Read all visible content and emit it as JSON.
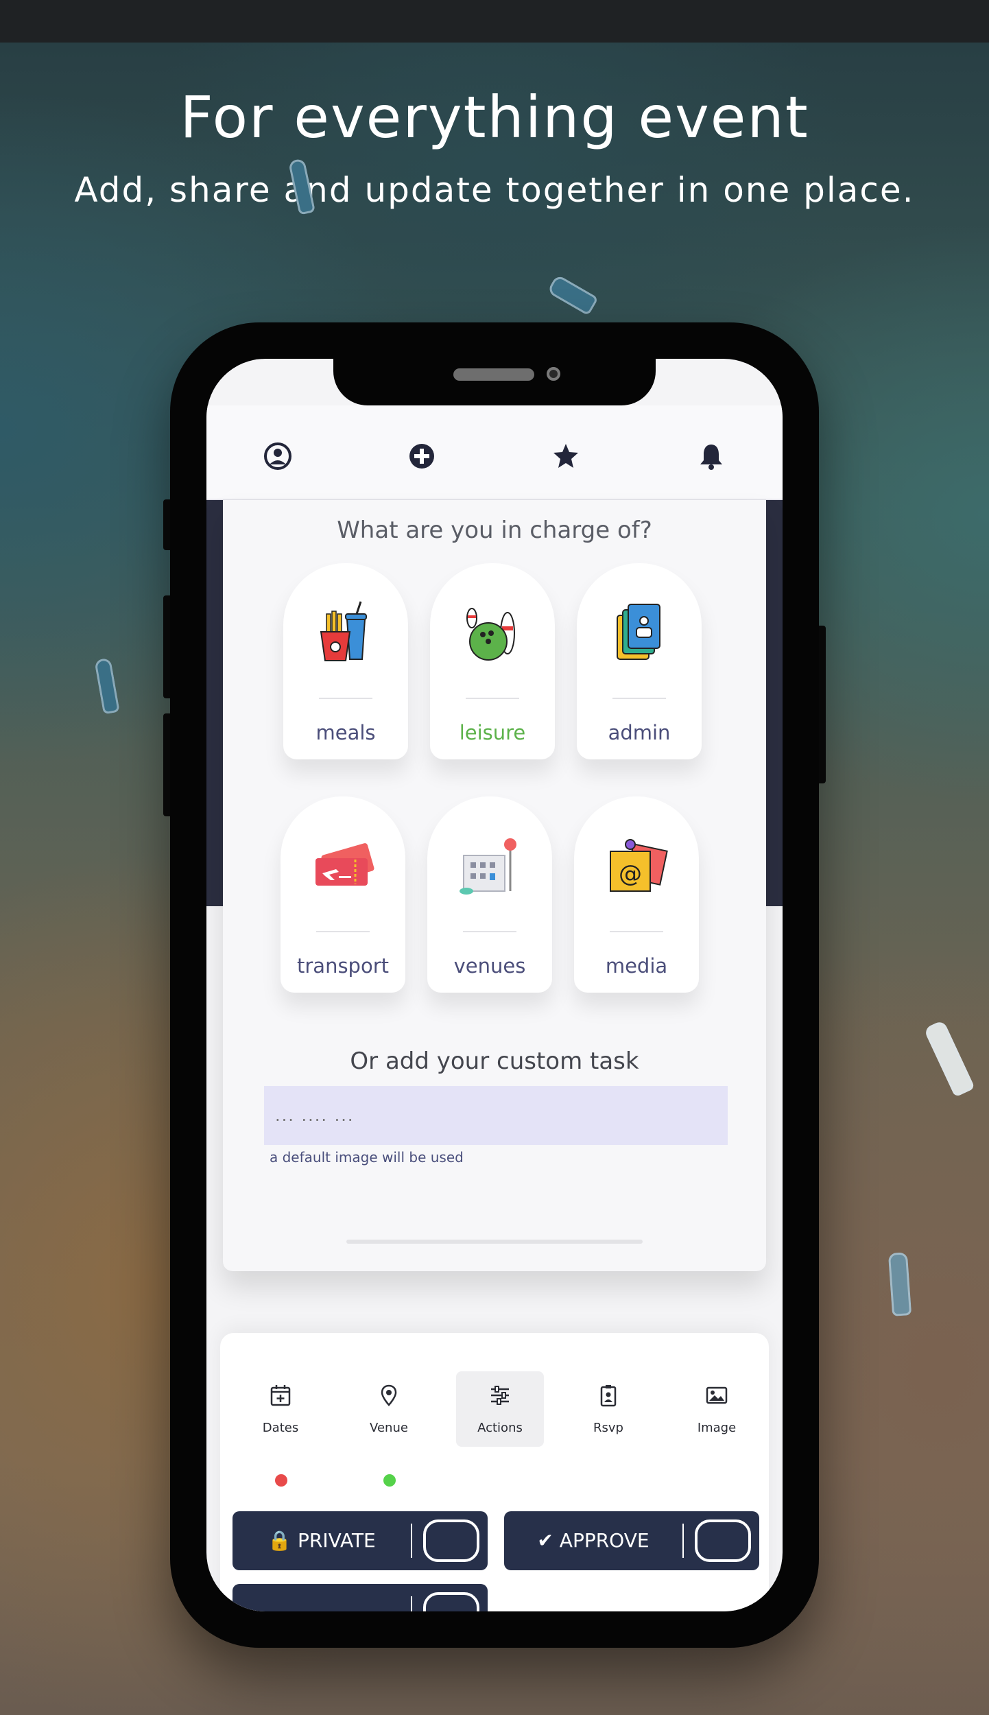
{
  "hero": {
    "title": "For everything event",
    "subtitle": "Add, share and update together in one place."
  },
  "appbar": {
    "icons": [
      "user-icon",
      "add-circle-icon",
      "star-icon",
      "bell-icon"
    ]
  },
  "card": {
    "title": "What are you in charge of?",
    "categories": [
      {
        "label": "meals",
        "icon": "meals-icon",
        "selected": false
      },
      {
        "label": "leisure",
        "icon": "bowling-icon",
        "selected": true
      },
      {
        "label": "admin",
        "icon": "documents-icon",
        "selected": false
      },
      {
        "label": "transport",
        "icon": "ticket-icon",
        "selected": false
      },
      {
        "label": "venues",
        "icon": "building-icon",
        "selected": false
      },
      {
        "label": "media",
        "icon": "sticky-note-icon",
        "selected": false
      }
    ],
    "custom_label": "Or add your custom task",
    "custom_placeholder": "... .... ...",
    "custom_hint": "a default image will be used"
  },
  "bottom_nav": {
    "items": [
      {
        "label": "Dates",
        "icon": "calendar-icon"
      },
      {
        "label": "Venue",
        "icon": "location-pin-icon"
      },
      {
        "label": "Actions",
        "icon": "sliders-icon",
        "active": true
      },
      {
        "label": "Rsvp",
        "icon": "badge-icon"
      },
      {
        "label": "Image",
        "icon": "image-icon"
      }
    ]
  },
  "status_dots": {
    "dates": "#e84a4a",
    "venue": "#55d24a"
  },
  "toggles": {
    "private_label": "PRIVATE",
    "approve_label": "APPROVE",
    "third_label": ""
  },
  "colors": {
    "accent_selected": "#5cb24a",
    "button_bg": "#27304a",
    "label": "#4b4e7a",
    "input_bg": "#e4e3f7"
  }
}
